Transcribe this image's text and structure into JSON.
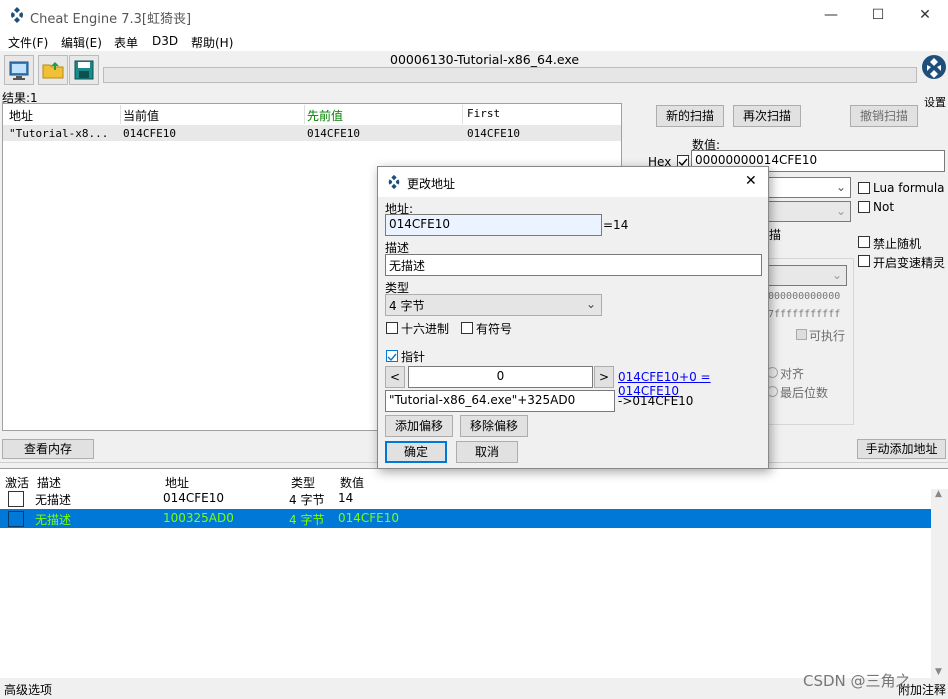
{
  "window": {
    "title": "Cheat Engine 7.3[虹猗丧]",
    "min": "—",
    "max": "☐",
    "close": "✕"
  },
  "menu": [
    "文件(F)",
    "编辑(E)",
    "表单",
    "D3D",
    "帮助(H)"
  ],
  "process_name": "00006130-Tutorial-x86_64.exe",
  "settings_label": "设置",
  "results_label": "结果:1",
  "scan_list": {
    "headers": [
      "地址",
      "当前值",
      "先前值",
      "First"
    ],
    "rows": [
      [
        "\"Tutorial-x8...",
        "014CFE10",
        "014CFE10",
        "014CFE10"
      ]
    ]
  },
  "right_panel": {
    "new_scan": "新的扫描",
    "next_scan": "再次扫描",
    "undo_scan": "撤销扫描",
    "value_label": "数值:",
    "hex_label": "Hex",
    "value": "00000000014CFE10",
    "lua_formula": "Lua formula",
    "not_label": "Not",
    "scan_partial": "描",
    "disable_random": "禁止随机",
    "speedhack": "开启变速精灵",
    "range_start": "000000000000",
    "range_end": "7fffffffffff",
    "executable": "可执行",
    "align": "对齐",
    "last_digits": "最后位数"
  },
  "view_memory": "查看内存",
  "manual_add": "手动添加地址",
  "cheat_table": {
    "headers": [
      "激活",
      "描述",
      "地址",
      "类型",
      "数值"
    ],
    "rows": [
      {
        "desc": "无描述",
        "address": "014CFE10",
        "type": "4 字节",
        "value": "14"
      },
      {
        "desc": "无描述",
        "address": "100325AD0",
        "type": "4 字节",
        "value": "014CFE10"
      }
    ]
  },
  "status": {
    "advanced": "高级选项",
    "annotations": "附加注释"
  },
  "watermark": "CSDN @三角之",
  "dialog": {
    "title": "更改地址",
    "close": "✕",
    "address_label": "地址:",
    "address": "014CFE10",
    "address_result": "=14",
    "desc_label": "描述",
    "desc": "无描述",
    "type_label": "类型",
    "type": "4 字节",
    "hex": "十六进制",
    "signed": "有符号",
    "pointer": "指针",
    "prev": "<",
    "offset": "0",
    "next": ">",
    "offset_link": "014CFE10+0 = 014CFE10",
    "base_address": "\"Tutorial-x86_64.exe\"+325AD0",
    "base_result": "->014CFE10",
    "add_offset": "添加偏移",
    "remove_offset": "移除偏移",
    "ok": "确定",
    "cancel": "取消"
  },
  "colors": {
    "selection": "#0078d7",
    "selected_text": "#7fff00",
    "prev_header": "#008000",
    "link": "#0000ff"
  }
}
